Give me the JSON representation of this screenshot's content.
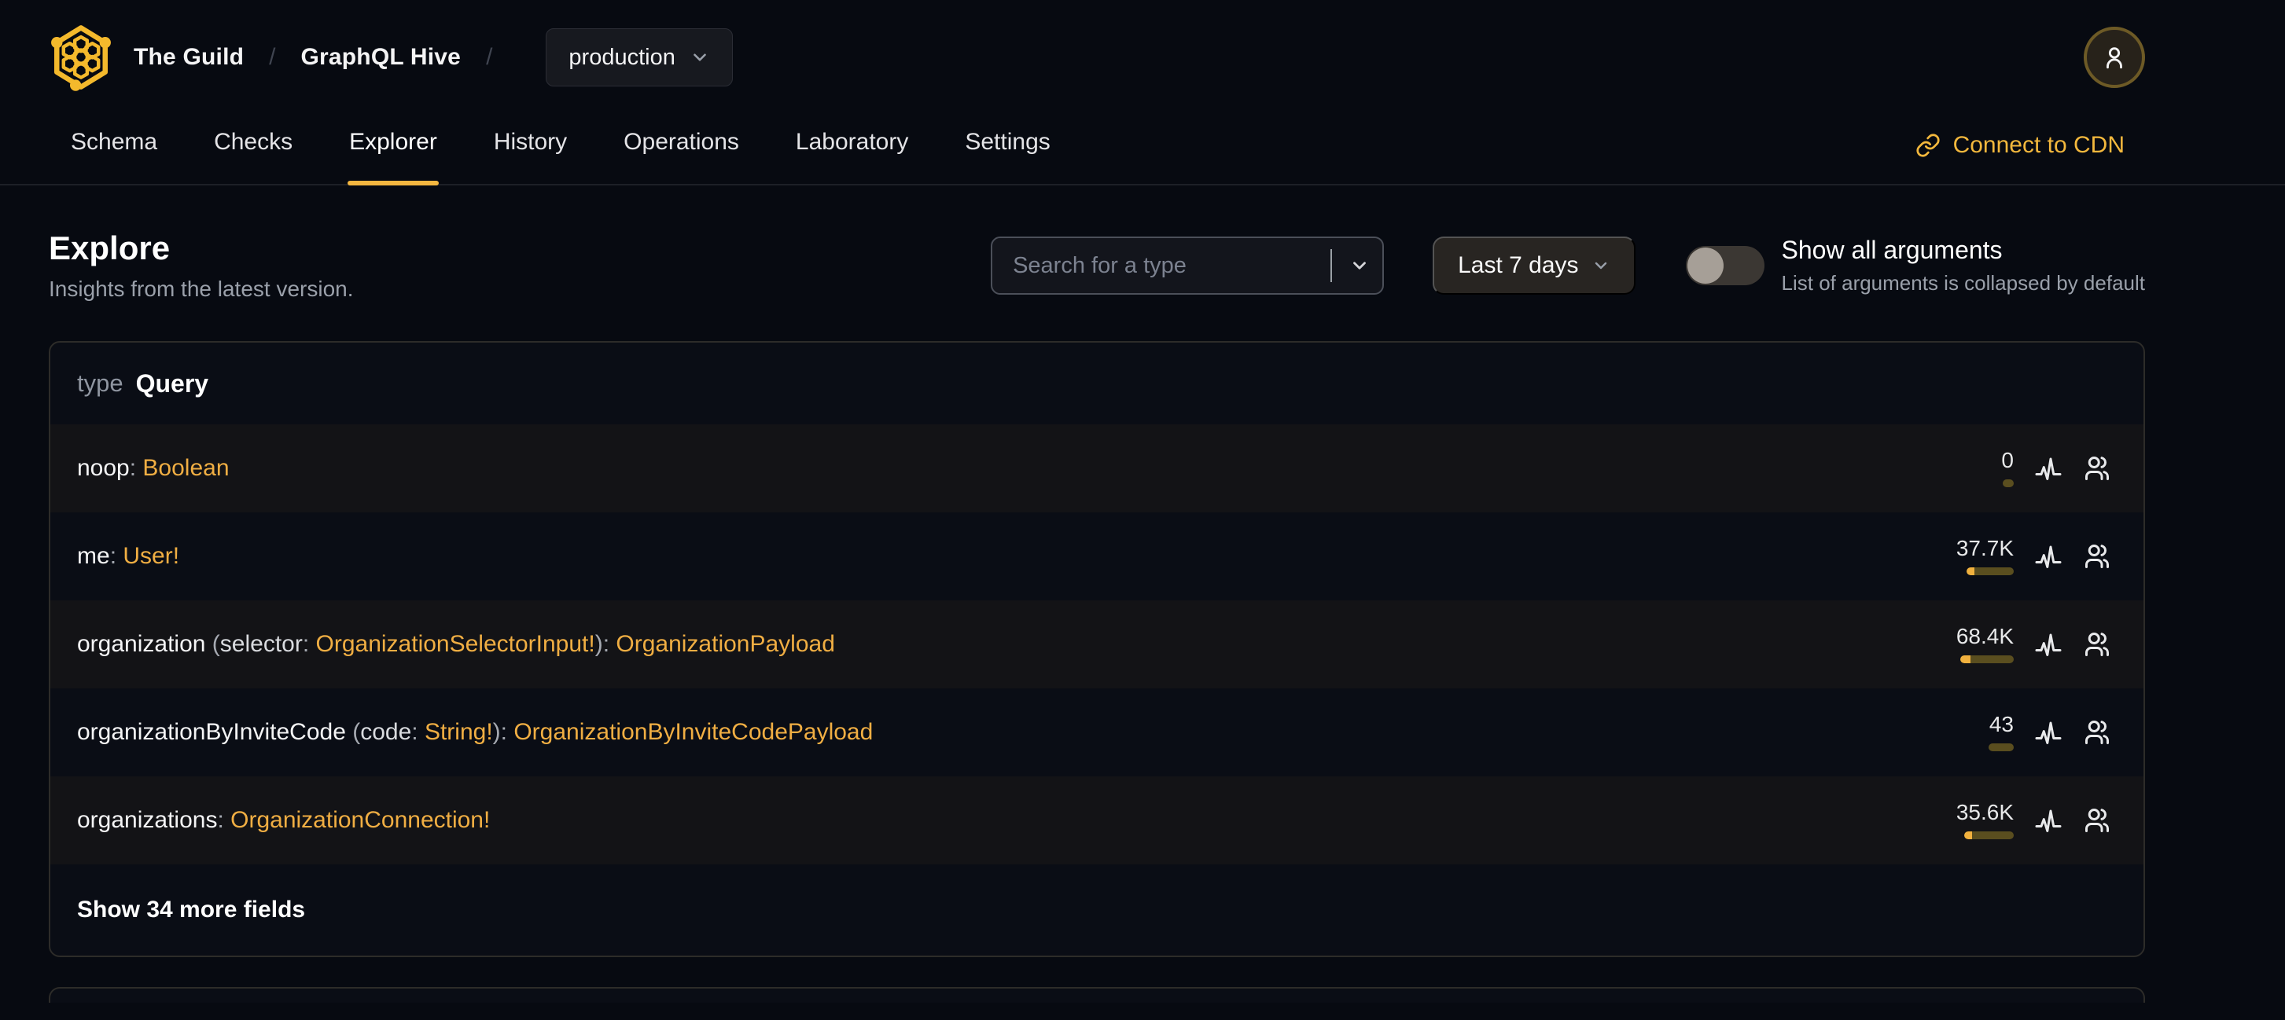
{
  "brand": {
    "org": "The Guild",
    "separator": "/",
    "project": "GraphQL Hive",
    "target_selector": {
      "value": "production"
    }
  },
  "tabs": [
    {
      "label": "Schema",
      "active": false
    },
    {
      "label": "Checks",
      "active": false
    },
    {
      "label": "Explorer",
      "active": true
    },
    {
      "label": "History",
      "active": false
    },
    {
      "label": "Operations",
      "active": false
    },
    {
      "label": "Laboratory",
      "active": false
    },
    {
      "label": "Settings",
      "active": false
    }
  ],
  "cdn_link": {
    "label": "Connect to CDN"
  },
  "page": {
    "title": "Explore",
    "subtitle": "Insights from the latest version."
  },
  "controls": {
    "type_search": {
      "value": "",
      "placeholder": "Search for a type"
    },
    "period_select": {
      "value": "Last 7 days"
    },
    "arguments_toggle": {
      "state": "off",
      "label": "Show all arguments",
      "description": "List of arguments is collapsed by default"
    }
  },
  "schema_card": {
    "kind_label": "type",
    "type_name": "Query",
    "fields": [
      {
        "name": "noop",
        "args": [],
        "returns": "Boolean",
        "requests": "0",
        "bar": {
          "width": 14,
          "fill": 0
        }
      },
      {
        "name": "me",
        "args": [],
        "returns": "User!",
        "requests": "37.7K",
        "bar": {
          "width": 60,
          "fill": 10
        }
      },
      {
        "name": "organization",
        "args": [
          {
            "name": "selector",
            "type": "OrganizationSelectorInput!"
          }
        ],
        "returns": "OrganizationPayload",
        "requests": "68.4K",
        "bar": {
          "width": 68,
          "fill": 13
        }
      },
      {
        "name": "organizationByInviteCode",
        "args": [
          {
            "name": "code",
            "type": "String!"
          }
        ],
        "returns": "OrganizationByInviteCodePayload",
        "requests": "43",
        "bar": {
          "width": 32,
          "fill": 0
        }
      },
      {
        "name": "organizations",
        "args": [],
        "returns": "OrganizationConnection!",
        "requests": "35.6K",
        "bar": {
          "width": 63,
          "fill": 10
        }
      }
    ],
    "show_more_label": "Show 34 more fields"
  },
  "icons": {
    "logo": "hive-logo",
    "avatar": "user-icon",
    "cdn": "link-icon",
    "search_expand": "chevron-down-icon",
    "period_expand": "chevron-down-icon",
    "target_expand": "chevron-down-icon",
    "row_activity": "activity-icon",
    "row_users": "users-icon"
  },
  "colors": {
    "accent": "#f4b740",
    "type_text": "#f0ae43",
    "bar_fill": "#f1b13e",
    "bar_track": "#5a4e1f",
    "background": "#070a11",
    "card_background": "#0a0d15",
    "row_alt_background": "#131316"
  }
}
